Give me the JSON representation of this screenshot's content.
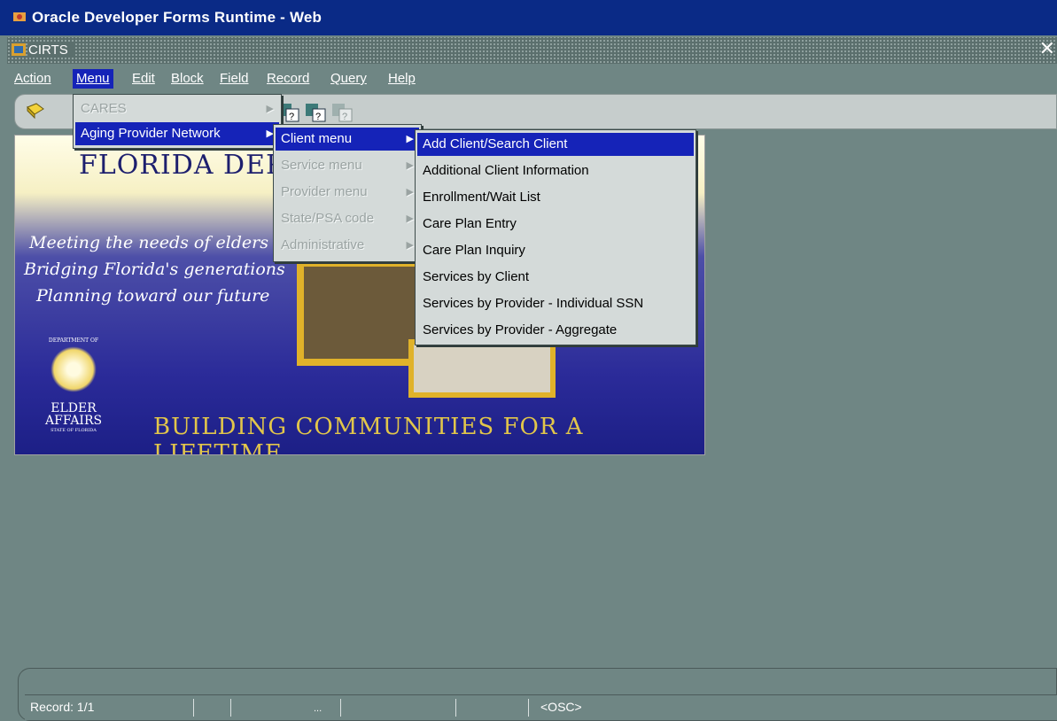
{
  "app": {
    "title": "Oracle Developer Forms Runtime - Web"
  },
  "window": {
    "title": "CIRTS",
    "close_glyph": "✕"
  },
  "menubar": {
    "items": [
      {
        "label": "Action"
      },
      {
        "label": "Menu"
      },
      {
        "label": "Edit"
      },
      {
        "label": "Block"
      },
      {
        "label": "Field"
      },
      {
        "label": "Record"
      },
      {
        "label": "Query"
      },
      {
        "label": "Help"
      }
    ],
    "active": "Menu"
  },
  "menu_level1": {
    "items": [
      {
        "label": "CARES",
        "enabled": false
      },
      {
        "label": "Aging Provider Network",
        "enabled": true,
        "highlighted": true
      }
    ]
  },
  "menu_level2": {
    "items": [
      {
        "label": "Client menu",
        "enabled": true,
        "highlighted": true
      },
      {
        "label": "Service menu",
        "enabled": false
      },
      {
        "label": "Provider menu",
        "enabled": false
      },
      {
        "label": "State/PSA code",
        "enabled": false
      },
      {
        "label": "Administrative",
        "enabled": false
      }
    ]
  },
  "menu_level3": {
    "items": [
      {
        "label": "Add Client/Search Client",
        "highlighted": true
      },
      {
        "label": "Additional Client Information"
      },
      {
        "label": "Enrollment/Wait List"
      },
      {
        "label": "Care Plan Entry"
      },
      {
        "label": "Care Plan Inquiry"
      },
      {
        "label": "Services by Client"
      },
      {
        "label": "Services by Provider - Individual SSN"
      },
      {
        "label": "Services by Provider - Aggregate"
      }
    ]
  },
  "banner": {
    "title": "FLORIDA DEPA",
    "lines": [
      "Meeting the needs of elders",
      "Bridging Florida's generations",
      "Planning toward our future"
    ],
    "bottom": "BUILDING COMMUNITIES FOR A LIFETIME",
    "logo": {
      "top": "DEPARTMENT OF",
      "word1": "ELDER",
      "word2": "AFFAIRS",
      "sub": "STATE OF FLORIDA"
    }
  },
  "status": {
    "record": "Record: 1/1",
    "ellipsis": "...",
    "osc": "<OSC>"
  },
  "colors": {
    "background": "#6f8684",
    "titlebar": "#0a2a86",
    "highlight": "#1523b8",
    "menu_bg": "#d4dad9"
  }
}
